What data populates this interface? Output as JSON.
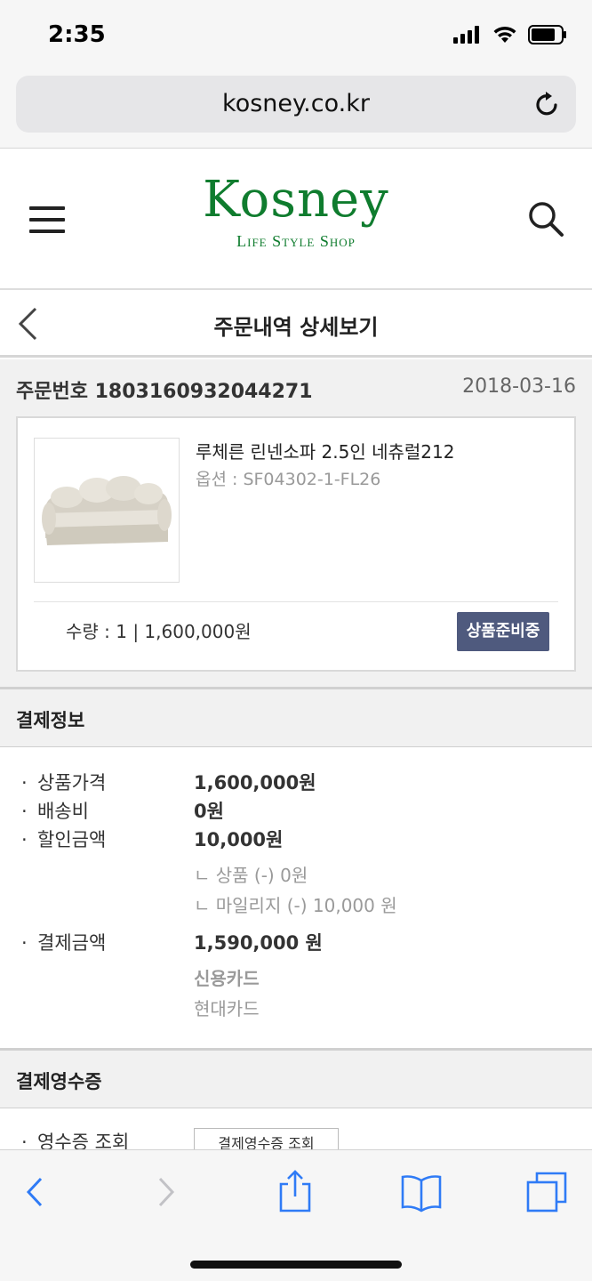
{
  "status_bar": {
    "time": "2:35"
  },
  "address_bar": {
    "url": "kosney.co.kr"
  },
  "header": {
    "logo_main": "Kosney",
    "logo_sub": "Life Style Shop"
  },
  "page": {
    "title": "주문내역 상세보기"
  },
  "order": {
    "number_label": "주문번호 1803160932044271",
    "date": "2018-03-16",
    "item": {
      "name": "루체른 린넨소파 2.5인 네츄럴212",
      "option": "옵션 : SF04302-1-FL26",
      "quantity_price": "수량 : 1 | 1,600,000원",
      "status": "상품준비중"
    }
  },
  "payment": {
    "section_title": "결제정보",
    "rows": [
      {
        "label": "상품가격",
        "value": "1,600,000원"
      },
      {
        "label": "배송비",
        "value": "0원"
      },
      {
        "label": "할인금액",
        "value": "10,000원"
      },
      {
        "label": "결제금액",
        "value": "1,590,000 원"
      }
    ],
    "discount_details": [
      "ㄴ 상품 (-) 0원",
      "ㄴ 마일리지 (-) 10,000 원"
    ],
    "method": "신용카드",
    "card": "현대카드"
  },
  "receipt": {
    "section_title": "결제영수증",
    "row_label": "영수증 조회",
    "button_label": "결제영수증 조회"
  },
  "colors": {
    "brand_green": "#0f7c2e",
    "badge_bg": "#4f5a7e",
    "ios_blue": "#2f7bf6"
  }
}
